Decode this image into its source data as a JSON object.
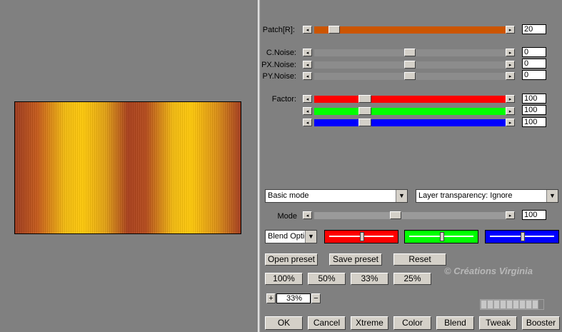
{
  "sliders": {
    "patch": {
      "label": "Patch[R]:",
      "value": "20",
      "level": 0.07
    },
    "cnoise": {
      "label": "C.Noise:",
      "value": "0",
      "level": 0.5
    },
    "pxnoise": {
      "label": "PX.Noise:",
      "value": "0",
      "level": 0.5
    },
    "pynoise": {
      "label": "PY.Noise:",
      "value": "0",
      "level": 0.5
    },
    "factor_label": "Factor:",
    "factor_r": {
      "value": "100",
      "level": 0.26
    },
    "factor_g": {
      "value": "100",
      "level": 0.26
    },
    "factor_b": {
      "value": "100",
      "level": 0.26
    },
    "mode": {
      "label": "Mode",
      "value": "100",
      "level": 0.42
    }
  },
  "dropdowns": {
    "mode_select": "Basic mode",
    "transparency_select": "Layer transparency: Ignore",
    "blend_select": "Blend Optio"
  },
  "color_sliders": {
    "red": {
      "color": "#ff0000",
      "level": 0.5
    },
    "green": {
      "color": "#00ff00",
      "level": 0.45
    },
    "blue": {
      "color": "#0000ff",
      "level": 0.45
    }
  },
  "preset_buttons": {
    "open": "Open preset",
    "save": "Save preset",
    "reset": "Reset"
  },
  "zoom_buttons": [
    "100%",
    "50%",
    "33%",
    "25%"
  ],
  "zoom": {
    "plus": "+",
    "value": "33%",
    "minus": "−"
  },
  "watermark": "© Créations Virginia",
  "bottom_buttons": {
    "ok": "OK",
    "cancel": "Cancel",
    "xtreme": "Xtreme",
    "color": "Color",
    "blend": "Blend",
    "tweak": "Tweak",
    "booster": "Booster"
  },
  "colors": {
    "patch_track": "#cc5500",
    "red": "#ff0000",
    "green": "#00ff00",
    "blue": "#0000ff",
    "gray_track": "#909090"
  }
}
